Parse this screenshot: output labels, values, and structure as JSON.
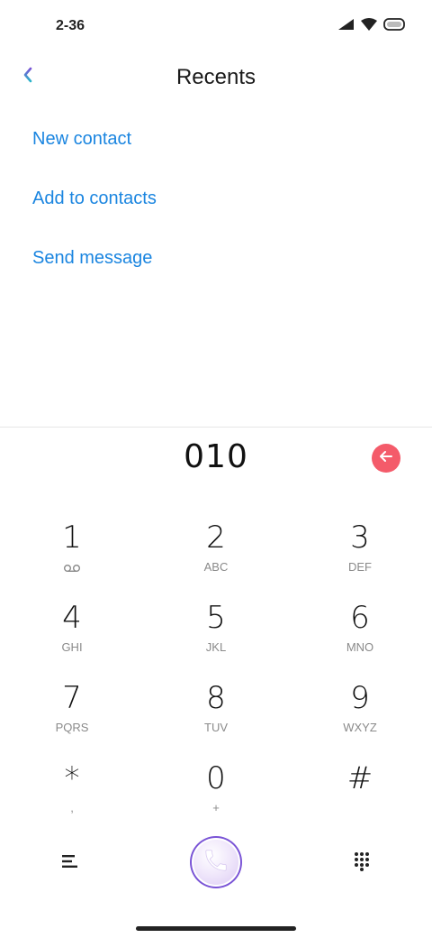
{
  "status_bar": {
    "time": "2-36",
    "icons": [
      "signal-icon",
      "wifi-icon",
      "battery-icon"
    ]
  },
  "header": {
    "back_icon": "chevron-left-icon",
    "title": "Recents"
  },
  "actions": [
    {
      "label": "New contact"
    },
    {
      "label": "Add to contacts"
    },
    {
      "label": "Send message"
    }
  ],
  "dialer": {
    "number": "010",
    "backspace_icon": "backspace-arrow-icon",
    "backspace_color": "#f45b6a"
  },
  "keypad": [
    {
      "digit": "1",
      "letters": "",
      "sub_icon": "voicemail-icon"
    },
    {
      "digit": "2",
      "letters": "ABC"
    },
    {
      "digit": "3",
      "letters": "DEF"
    },
    {
      "digit": "4",
      "letters": "GHI"
    },
    {
      "digit": "5",
      "letters": "JKL"
    },
    {
      "digit": "6",
      "letters": "MNO"
    },
    {
      "digit": "7",
      "letters": "PQRS"
    },
    {
      "digit": "8",
      "letters": "TUV"
    },
    {
      "digit": "9",
      "letters": "WXYZ"
    },
    {
      "digit": "*",
      "letters": ","
    },
    {
      "digit": "0",
      "letters": "+"
    },
    {
      "digit": "#",
      "letters": ""
    }
  ],
  "bottom_bar": {
    "menu_icon": "menu-lines-icon",
    "call_icon": "phone-icon",
    "dialpad_icon": "dialpad-grid-icon"
  },
  "colors": {
    "link": "#1a85e0",
    "accent_purple": "#7a54d6",
    "backspace_red": "#f45b6a"
  }
}
